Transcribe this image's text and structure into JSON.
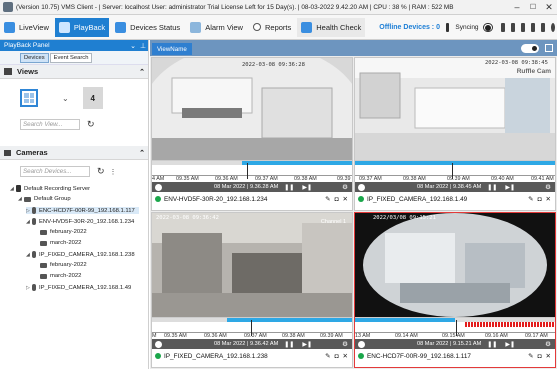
{
  "window": {
    "title": "(Version 10.75) VMS Client -  | Server: localhost  User: administrator Trial License Left for 15 Day(s). | 08-03-2022 9.42.20 AM  | CPU : 38 % | RAM : 522 MB",
    "minimize": "–",
    "close": "✕"
  },
  "menu": {
    "tabs": [
      "LiveView",
      "PlayBack",
      "Devices Status",
      "Alarm View",
      "Reports",
      "Health Check"
    ],
    "offline": "Offline Devices : 0",
    "syncing": "Syncing"
  },
  "panel": {
    "title": "PlayBack Panel",
    "subtabs": [
      "Devices",
      "Event Search"
    ],
    "views_title": "Views",
    "layout_value": "4",
    "views_search_placeholder": "Search View...",
    "cameras_title": "Cameras",
    "cameras_search_placeholder": "Search Devices...",
    "tree": [
      "Default Recording Server",
      "Default Group",
      "ENC-HCD7F-00R-99_192.168.1.117",
      "ENV-HVD5F-30R-20_192.168.1.234",
      "february-2022",
      "march-2022",
      "IP_FIXED_CAMERA_192.168.1.238",
      "february-2022",
      "march-2022",
      "IP_FIXED_CAMERA_192.168.1.49"
    ]
  },
  "view_tab": "ViewName",
  "tiles": [
    {
      "name": "ENV-HVD5F-30R-20_192.168.1.234",
      "date": "08 Mar 2022 | 9.36.28 AM",
      "ticks": [
        "4 AM",
        "09.35 AM",
        "09.36 AM",
        "09.37 AM",
        "09.38 AM",
        "09.39"
      ],
      "osd": "2022-03-08 09:36:28"
    },
    {
      "name": "IP_FIXED_CAMERA_192.168.1.49",
      "date": "08 Mar 2022 | 9.38.45 AM",
      "ticks": [
        "09.37 AM",
        "09.38 AM",
        "09.39 AM",
        "09.40 AM",
        "09.41 AM"
      ],
      "osd": "2022-03-08 09:38:45",
      "brand": "Ruffle Cam"
    },
    {
      "name": "IP_FIXED_CAMERA_192.168.1.238",
      "date": "08 Mar 2022 | 9.36.42 AM",
      "ticks": [
        "M",
        "09.35 AM",
        "09.36 AM",
        "09.37 AM",
        "09.38 AM",
        "09.39 AM"
      ],
      "osd": "2022-03-08 09:36:42",
      "channel": "Channel 1"
    },
    {
      "name": "ENC-HCD7F-00R-99_192.168.1.117",
      "date": "08 Mar 2022 | 9.15.21 AM",
      "ticks": [
        "13 AM",
        "09.14 AM",
        "09.15 AM",
        "09.16 AM",
        "09.17 AM"
      ],
      "osd": "2022/03/08 09:15:21"
    }
  ],
  "colors": {
    "accent": "#1f7fd1",
    "timeline": "#2ea8e5",
    "recording_red": "#e21d1d",
    "selected_border": "#e33a3a",
    "online_dot": "#1aa64a"
  }
}
